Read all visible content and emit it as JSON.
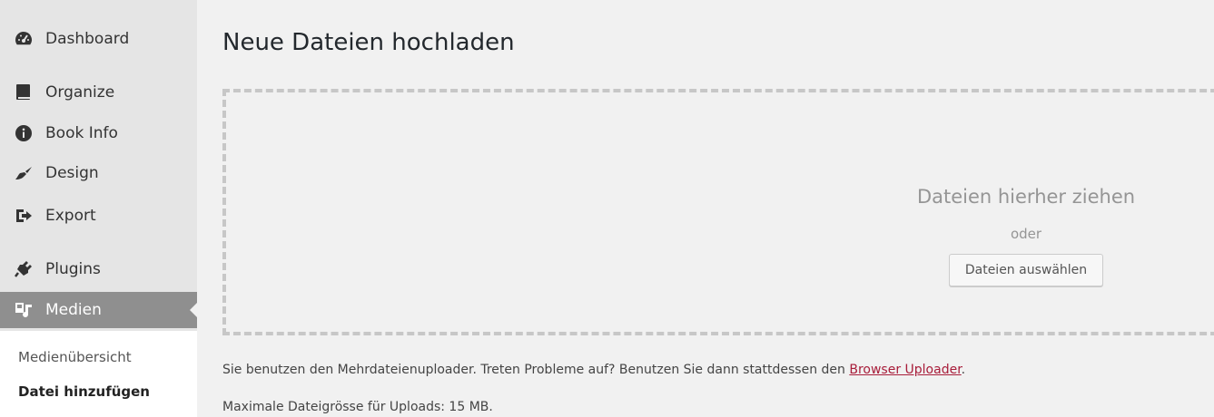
{
  "sidebar": {
    "items": [
      {
        "label": "Dashboard",
        "icon": "dashboard-icon"
      },
      {
        "label": "Organize",
        "icon": "book-icon"
      },
      {
        "label": "Book Info",
        "icon": "info-icon"
      },
      {
        "label": "Design",
        "icon": "brush-icon"
      },
      {
        "label": "Export",
        "icon": "export-icon"
      },
      {
        "label": "Plugins",
        "icon": "plugin-icon"
      },
      {
        "label": "Medien",
        "icon": "media-icon",
        "active": true
      }
    ],
    "submenu": [
      {
        "label": "Medienübersicht"
      },
      {
        "label": "Datei hinzufügen",
        "current": true
      }
    ]
  },
  "main": {
    "title": "Neue Dateien hochladen",
    "drop_zone": {
      "drop_text": "Dateien hierher ziehen",
      "or_text": "oder",
      "select_button": "Dateien auswählen"
    },
    "info": {
      "text_before": "Sie benutzen den Mehrdateienuploader. Treten Probleme auf? Benutzen Sie dann stattdessen den ",
      "link": "Browser Uploader",
      "text_after": "."
    },
    "max_size": "Maximale Dateigrösse für Uploads: 15 MB."
  },
  "colors": {
    "sidebar_bg": "#e5e5e5",
    "active_bg": "#8f8f8f",
    "link": "#a81d3a",
    "page_bg": "#f1f1f1"
  }
}
